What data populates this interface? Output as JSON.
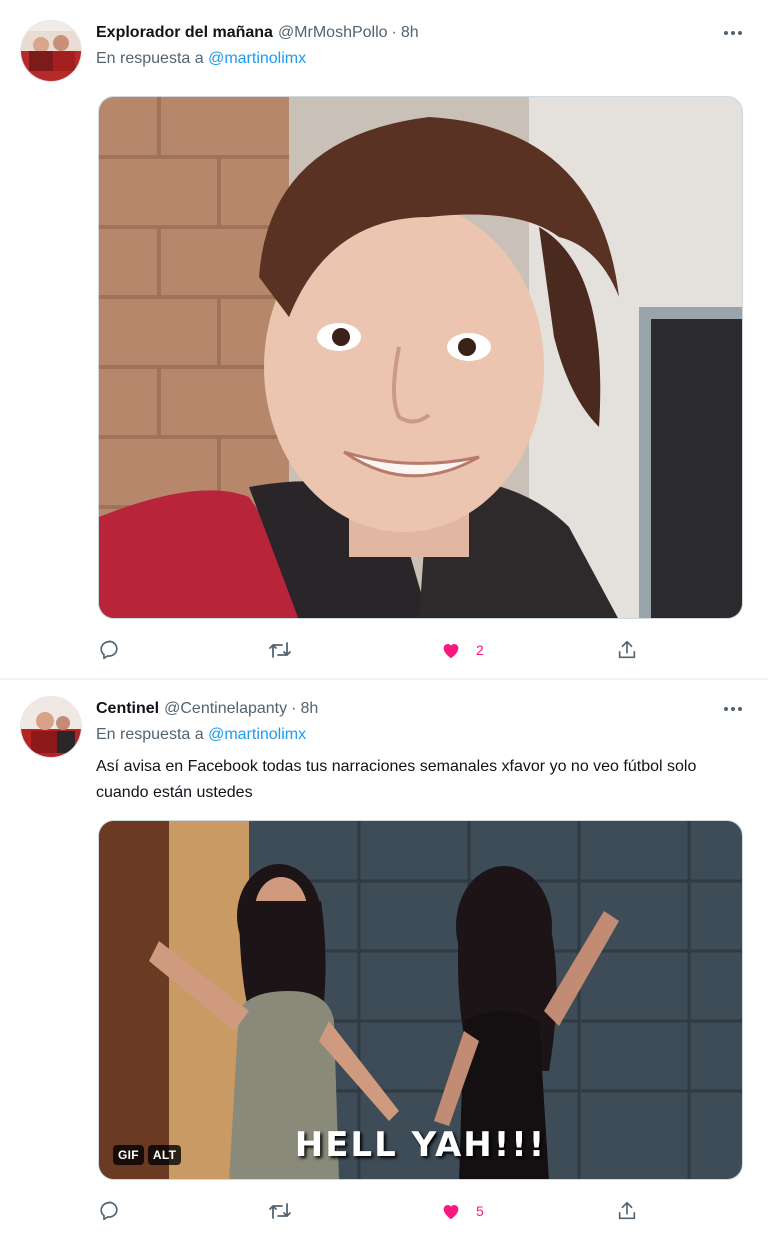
{
  "tweets": [
    {
      "name": "Explorador del mañana",
      "handle": "@MrMoshPollo",
      "dot": "·",
      "time": "8h",
      "reply_prefix": "En respuesta a",
      "reply_to": "@martinolimx",
      "text": "",
      "media_type": "photo",
      "likes": "2",
      "liked": true
    },
    {
      "name": "Centinel",
      "handle": "@Centinelapanty",
      "dot": "·",
      "time": "8h",
      "reply_prefix": "En respuesta a",
      "reply_to": "@martinolimx",
      "text": "Así avisa en Facebook todas tus narraciones semanales xfavor yo no veo fútbol solo cuando están ustedes",
      "media_type": "gif",
      "media_caption": "HELL YAH!!!",
      "badges": [
        "GIF",
        "ALT"
      ],
      "likes": "5",
      "liked": true
    }
  ],
  "icons": {
    "more": "more-icon",
    "reply": "reply-icon",
    "retweet": "retweet-icon",
    "like": "heart-icon",
    "share": "share-icon"
  },
  "colors": {
    "like": "#f91880",
    "link": "#1d9bf0",
    "secondary_text": "#536471",
    "primary_text": "#0f1419"
  }
}
